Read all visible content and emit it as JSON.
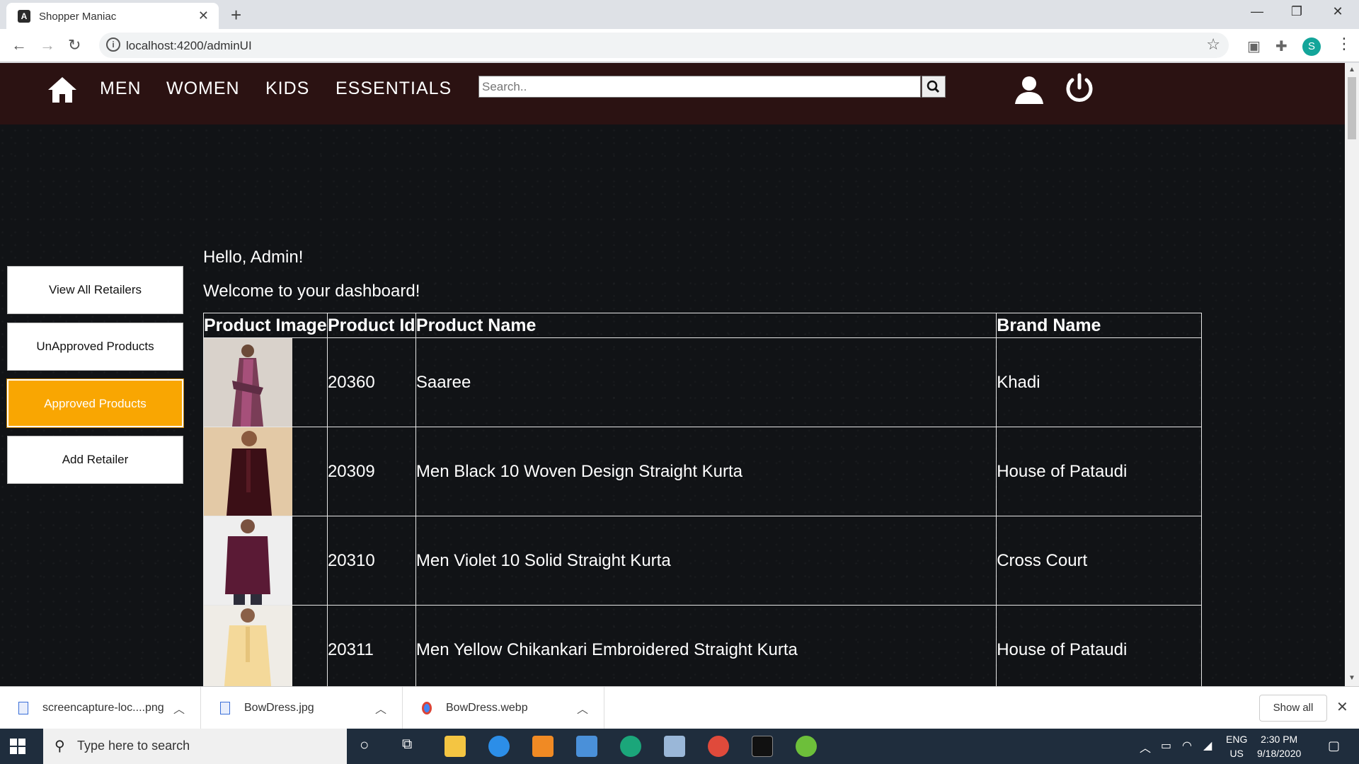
{
  "browser": {
    "tab_title": "Shopper Maniac",
    "url": "localhost:4200/adminUI",
    "profile_initial": "S"
  },
  "nav": {
    "links": [
      "MEN",
      "WOMEN",
      "KIDS",
      "ESSENTIALS"
    ],
    "search_placeholder": "Search.."
  },
  "sidebar": {
    "buttons": [
      {
        "label": "View All Retailers",
        "active": false
      },
      {
        "label": "UnApproved Products",
        "active": false
      },
      {
        "label": "Approved Products",
        "active": true
      },
      {
        "label": "Add Retailer",
        "active": false
      }
    ]
  },
  "main": {
    "greeting": "Hello, Admin!",
    "welcome": "Welcome to your dashboard!",
    "table": {
      "headers": [
        "Product Image",
        "Product Id",
        "Product Name",
        "Brand Name"
      ],
      "rows": [
        {
          "id": "20360",
          "name": "Saaree",
          "brand": "Khadi",
          "image": "saree-image"
        },
        {
          "id": "20309",
          "name": "Men Black 10 Woven Design Straight Kurta",
          "brand": "House of Pataudi",
          "image": "black-kurta-image"
        },
        {
          "id": "20310",
          "name": "Men Violet 10 Solid Straight Kurta",
          "brand": "Cross Court",
          "image": "violet-kurta-image"
        },
        {
          "id": "20311",
          "name": "Men Yellow Chikankari Embroidered Straight Kurta",
          "brand": "House of Pataudi",
          "image": "yellow-kurta-image"
        }
      ]
    }
  },
  "downloads": {
    "items": [
      "screencapture-loc....png",
      "BowDress.jpg",
      "BowDress.webp"
    ],
    "show_all": "Show all"
  },
  "taskbar": {
    "search_placeholder": "Type here to search",
    "lang_top": "ENG",
    "lang_bottom": "US",
    "time": "2:30 PM",
    "date": "9/18/2020"
  },
  "colors": {
    "navbar": "#2b1212",
    "active_button": "#f9a602",
    "page_bg": "#111316"
  }
}
